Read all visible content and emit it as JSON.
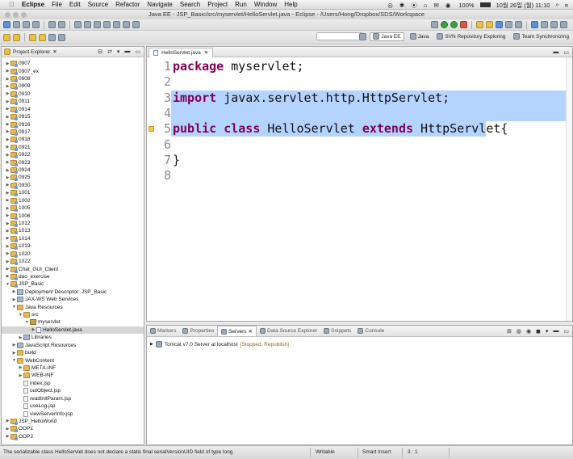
{
  "mac_menubar": {
    "app": "Eclipse",
    "items": [
      "File",
      "Edit",
      "Source",
      "Refactor",
      "Navigate",
      "Search",
      "Project",
      "Run",
      "Window",
      "Help"
    ],
    "battery": "100%",
    "datetime": "10월 26일 (월)  11:10"
  },
  "window_title": "Java EE - JSP_Basic/src/myservlet/HelloServlet.java - Eclipse - /Users/Hong/Dropbox/SDS/Workspace",
  "perspectives": [
    {
      "label": "Java EE",
      "active": true
    },
    {
      "label": "Java",
      "active": false
    },
    {
      "label": "SVN Repository Exploring",
      "active": false
    },
    {
      "label": "Team Synchronizing",
      "active": false
    }
  ],
  "explorer": {
    "tab_label": "Project Explorer",
    "items": [
      {
        "label": "0907",
        "depth": 0,
        "type": "proj",
        "open": false
      },
      {
        "label": "0907_ex",
        "depth": 0,
        "type": "proj",
        "open": false
      },
      {
        "label": "0908",
        "depth": 0,
        "type": "proj",
        "open": false
      },
      {
        "label": "0909",
        "depth": 0,
        "type": "proj",
        "open": false
      },
      {
        "label": "0910",
        "depth": 0,
        "type": "proj",
        "open": false
      },
      {
        "label": "0911",
        "depth": 0,
        "type": "proj",
        "open": false
      },
      {
        "label": "0914",
        "depth": 0,
        "type": "proj",
        "open": false
      },
      {
        "label": "0915",
        "depth": 0,
        "type": "proj",
        "open": false
      },
      {
        "label": "0916",
        "depth": 0,
        "type": "proj",
        "open": false
      },
      {
        "label": "0917",
        "depth": 0,
        "type": "proj",
        "open": false
      },
      {
        "label": "0918",
        "depth": 0,
        "type": "proj",
        "open": false
      },
      {
        "label": "0921",
        "depth": 0,
        "type": "proj",
        "open": false
      },
      {
        "label": "0922",
        "depth": 0,
        "type": "proj",
        "open": false
      },
      {
        "label": "0923",
        "depth": 0,
        "type": "proj",
        "open": false
      },
      {
        "label": "0924",
        "depth": 0,
        "type": "proj",
        "open": false
      },
      {
        "label": "0925",
        "depth": 0,
        "type": "proj",
        "open": false
      },
      {
        "label": "0930",
        "depth": 0,
        "type": "proj",
        "open": false
      },
      {
        "label": "1001",
        "depth": 0,
        "type": "proj",
        "open": false
      },
      {
        "label": "1002",
        "depth": 0,
        "type": "proj",
        "open": false
      },
      {
        "label": "1005",
        "depth": 0,
        "type": "proj",
        "open": false
      },
      {
        "label": "1006",
        "depth": 0,
        "type": "proj",
        "open": false
      },
      {
        "label": "1012",
        "depth": 0,
        "type": "proj",
        "open": false
      },
      {
        "label": "1013",
        "depth": 0,
        "type": "proj",
        "open": false
      },
      {
        "label": "1014",
        "depth": 0,
        "type": "proj",
        "open": false
      },
      {
        "label": "1019",
        "depth": 0,
        "type": "proj",
        "open": false
      },
      {
        "label": "1020",
        "depth": 0,
        "type": "proj",
        "open": false
      },
      {
        "label": "1022",
        "depth": 0,
        "type": "proj",
        "open": false
      },
      {
        "label": "Chat_GUI_Client",
        "depth": 0,
        "type": "proj",
        "open": false
      },
      {
        "label": "dao_exercise",
        "depth": 0,
        "type": "proj",
        "open": false
      },
      {
        "label": "JSP_Basic",
        "depth": 0,
        "type": "proj",
        "open": true
      },
      {
        "label": "Deployment Descriptor: JSP_Basic",
        "depth": 1,
        "type": "lib",
        "open": false
      },
      {
        "label": "JAX-WS Web Services",
        "depth": 1,
        "type": "lib",
        "open": false
      },
      {
        "label": "Java Resources",
        "depth": 1,
        "type": "folder",
        "open": true
      },
      {
        "label": "src",
        "depth": 2,
        "type": "folder",
        "open": true
      },
      {
        "label": "myservlet",
        "depth": 3,
        "type": "pkg",
        "open": true
      },
      {
        "label": "HelloServlet.java",
        "depth": 4,
        "type": "java",
        "open": false,
        "selected": true
      },
      {
        "label": "Libraries",
        "depth": 2,
        "type": "lib",
        "open": false
      },
      {
        "label": "JavaScript Resources",
        "depth": 1,
        "type": "lib",
        "open": false
      },
      {
        "label": "build",
        "depth": 1,
        "type": "folder",
        "open": false
      },
      {
        "label": "WebContent",
        "depth": 1,
        "type": "folder",
        "open": true
      },
      {
        "label": "META-INF",
        "depth": 2,
        "type": "folder",
        "open": false
      },
      {
        "label": "WEB-INF",
        "depth": 2,
        "type": "folder",
        "open": false
      },
      {
        "label": "index.jsp",
        "depth": 2,
        "type": "file",
        "leaf": true
      },
      {
        "label": "outObject.jsp",
        "depth": 2,
        "type": "file",
        "leaf": true
      },
      {
        "label": "readInitParam.jsp",
        "depth": 2,
        "type": "file",
        "leaf": true
      },
      {
        "label": "useLog.jsp",
        "depth": 2,
        "type": "file",
        "leaf": true
      },
      {
        "label": "viewServerInfo.jsp",
        "depth": 2,
        "type": "file",
        "leaf": true
      },
      {
        "label": "JSP_HelloWorld",
        "depth": 0,
        "type": "proj",
        "open": false
      },
      {
        "label": "OOP1",
        "depth": 0,
        "type": "proj",
        "open": false
      },
      {
        "label": "OOP2",
        "depth": 0,
        "type": "proj",
        "open": false
      }
    ]
  },
  "editor": {
    "tab_label": "HelloServlet.java",
    "lines": [
      {
        "n": "1",
        "tokens": [
          {
            "t": "package",
            "kw": true
          },
          {
            "t": " myservlet;"
          }
        ]
      },
      {
        "n": "2",
        "tokens": []
      },
      {
        "n": "3",
        "tokens": [
          {
            "t": "import",
            "kw": true
          },
          {
            "t": " javax.servlet.http.HttpServlet;"
          }
        ],
        "highlight": true
      },
      {
        "n": "4",
        "tokens": [],
        "highlight": true
      },
      {
        "n": "5",
        "tokens": [
          {
            "t": "public",
            "kw": true
          },
          {
            "t": " "
          },
          {
            "t": "class",
            "kw": true
          },
          {
            "t": " HelloServlet "
          },
          {
            "t": "extends",
            "kw": true
          },
          {
            "t": " HttpServlet{"
          }
        ],
        "highlight": true,
        "warning": true
      },
      {
        "n": "6",
        "tokens": []
      },
      {
        "n": "7",
        "tokens": [
          {
            "t": "}"
          }
        ]
      },
      {
        "n": "8",
        "tokens": []
      }
    ]
  },
  "bottom_panel": {
    "tabs": [
      {
        "label": "Markers",
        "active": false
      },
      {
        "label": "Properties",
        "active": false
      },
      {
        "label": "Servers",
        "active": true
      },
      {
        "label": "Data Source Explorer",
        "active": false
      },
      {
        "label": "Snippets",
        "active": false
      },
      {
        "label": "Console",
        "active": false
      }
    ],
    "server_name": "Tomcat v7.0 Server at localhost",
    "server_status": "[Stopped, Republish]"
  },
  "statusbar": {
    "message": "The serializable class HelloServlet does not declare a static final serialVersionUID field of type long",
    "writable": "Writable",
    "insert_mode": "Smart Insert",
    "position": "3 : 1"
  },
  "colors": {
    "keyword": "#7f0055",
    "selection": "#b5d3ff",
    "server_status": "#8a6a20"
  }
}
